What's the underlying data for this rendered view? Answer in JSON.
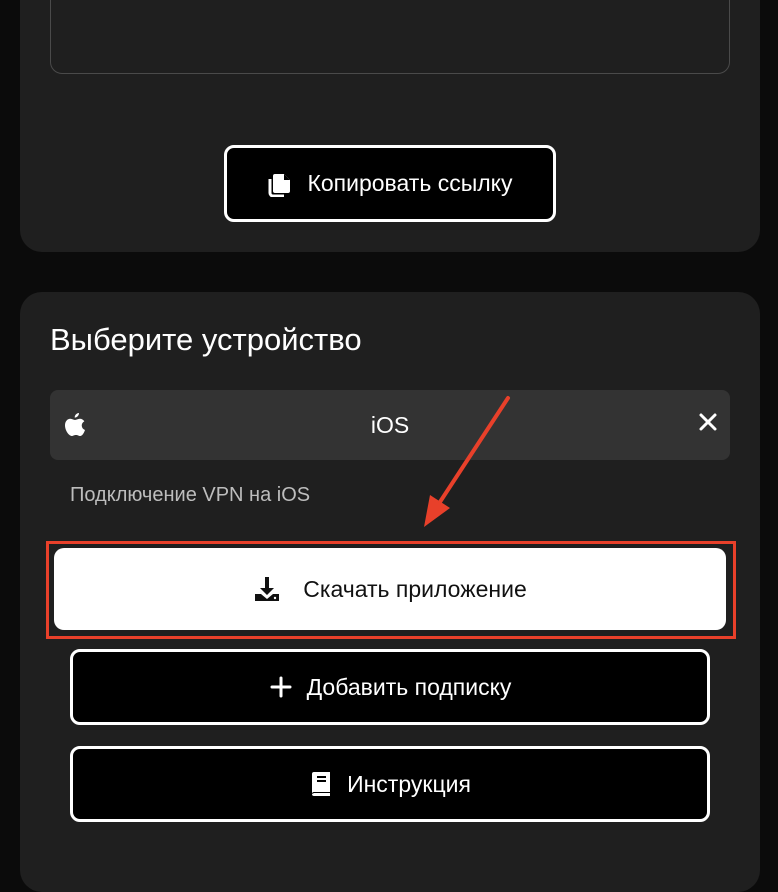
{
  "link_card": {
    "copy_button_label": "Копировать ссылку"
  },
  "device_card": {
    "title": "Выберите устройство",
    "selected_device": "iOS",
    "hint": "Подключение VPN на iOS",
    "download_button_label": "Скачать приложение",
    "add_subscription_button_label": "Добавить подписку",
    "instructions_button_label": "Инструкция"
  },
  "icons": {
    "copy": "copy-icon",
    "apple": "apple-icon",
    "close": "close-icon",
    "download": "download-icon",
    "plus": "plus-icon",
    "book": "book-icon"
  },
  "colors": {
    "background": "#0b0b0b",
    "card": "#1f1f1f",
    "select": "#333333",
    "annotation_red": "#e8402a",
    "primary_button": "#ffffff"
  }
}
